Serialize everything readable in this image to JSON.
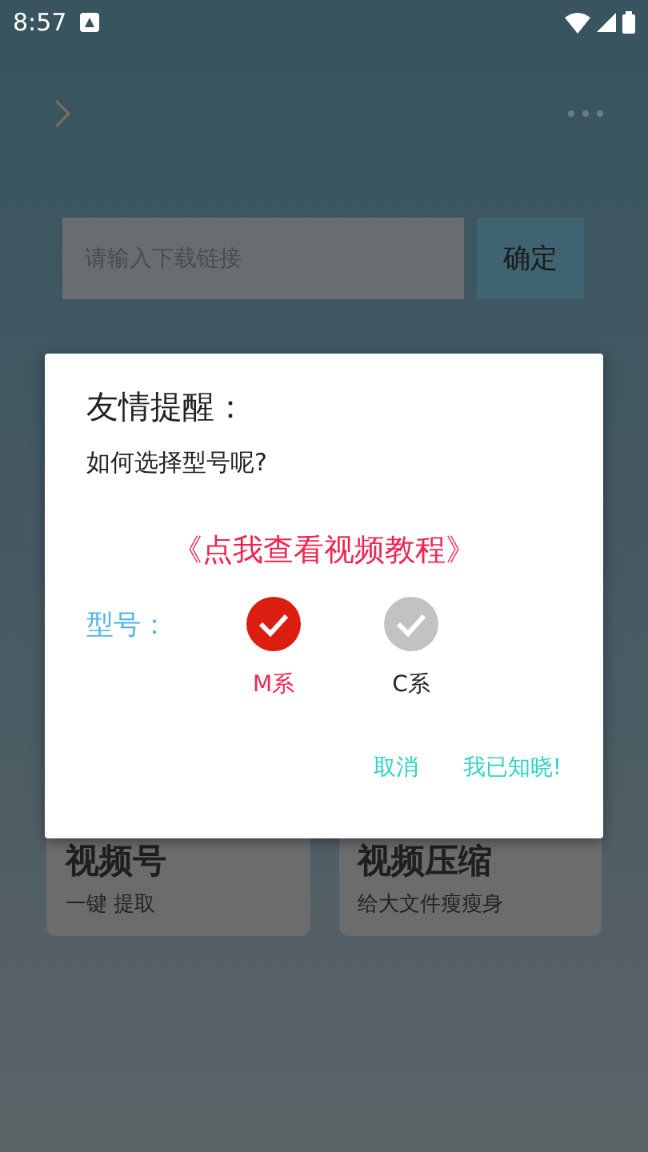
{
  "status_bar": {
    "time": "8:57"
  },
  "download": {
    "placeholder": "请输入下载链接",
    "confirm": "确定"
  },
  "cards": [
    {
      "title": "视频号",
      "subtitle": "一键 提取"
    },
    {
      "title": "视频压缩",
      "subtitle": "给大文件瘦瘦身"
    }
  ],
  "dialog": {
    "title": "友情提醒：",
    "question": "如何选择型号呢?",
    "tutorial_link": "《点我查看视频教程》",
    "model_label": "型号：",
    "models": [
      {
        "label": "M系",
        "selected": true
      },
      {
        "label": "C系",
        "selected": false
      }
    ],
    "buttons": [
      "取消",
      "我已知晓!"
    ]
  }
}
